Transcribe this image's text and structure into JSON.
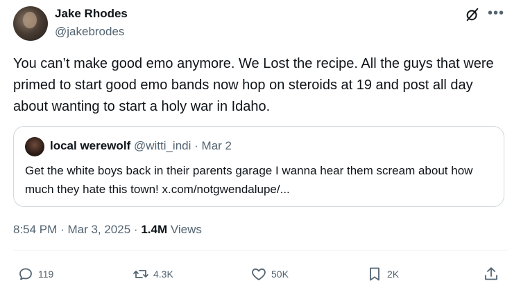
{
  "author": {
    "display_name": "Jake Rhodes",
    "handle": "@jakebrodes"
  },
  "tweet": {
    "text": "You can’t make good emo anymore. We Lost the recipe. All the guys that were primed to start good emo bands now hop on steroids at 19 and post all day about wanting to start a holy war in Idaho."
  },
  "quoted": {
    "display_name": "local werewolf",
    "handle": "@witti_indi",
    "separator": "·",
    "date": "Mar 2",
    "text": "Get the white boys back in their parents garage I wanna hear them scream about how much they hate this town! x.com/notgwendalupe/..."
  },
  "meta": {
    "time": "8:54 PM",
    "separator": "·",
    "date": "Mar 3, 2025",
    "separator2": "·",
    "views_count": "1.4M",
    "views_label": "Views"
  },
  "actions": {
    "replies": "119",
    "reposts": "4.3K",
    "likes": "50K",
    "bookmarks": "2K"
  },
  "icons": [
    "grok-icon",
    "more-icon",
    "reply-icon",
    "repost-icon",
    "like-icon",
    "bookmark-icon",
    "share-icon"
  ],
  "colors": {
    "text": "#0f1419",
    "secondary": "#536471",
    "border": "#cfd9de"
  }
}
